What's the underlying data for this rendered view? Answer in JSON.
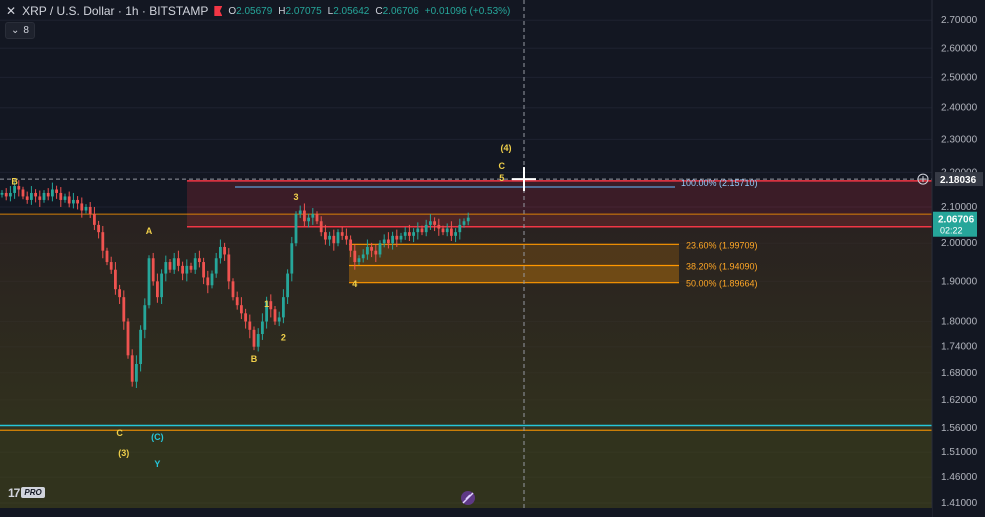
{
  "header": {
    "symbol": "XRP / U.S. Dollar · 1h · BITSTAMP",
    "ohlc": {
      "o": "2.05679",
      "h": "2.07075",
      "l": "2.05642",
      "c": "2.06706",
      "change": "+0.01096 (+0.53%)"
    },
    "indicators_count": "8"
  },
  "colors": {
    "background": "#131722",
    "up": "#26a69a",
    "down": "#ef5350",
    "fib_line": "#ff9800",
    "pink_zone": "#f23645",
    "cyan_line": "#26c6da",
    "wave_yellow": "#f0d04a",
    "wave_teal": "#26c6da",
    "label_orange": "#ffa726",
    "label_blue": "#90caf9"
  },
  "icons": {
    "close": "close-icon",
    "collapse": "chevron-down-icon",
    "add_price": "plus-circle-icon",
    "logo": "tradingview-logo",
    "rocket": "rocket-icon"
  },
  "price_axis": {
    "ticks": [
      "2.70000",
      "2.60000",
      "2.50000",
      "2.40000",
      "2.30000",
      "2.20000",
      "2.10000",
      "2.00000",
      "1.90000",
      "1.80000",
      "1.74000",
      "1.68000",
      "1.62000",
      "1.56000",
      "1.51000",
      "1.46000",
      "1.41000"
    ],
    "crosshair_price": "2.18036",
    "current_price": "2.06706",
    "countdown": "02:22"
  },
  "fib_labels": [
    {
      "text": "100.00% (2.15710)",
      "price": 2.1571
    },
    {
      "text": "23.60% (1.99709)",
      "price": 1.99709
    },
    {
      "text": "38.20% (1.94090)",
      "price": 1.9409
    },
    {
      "text": "50.00% (1.89664)",
      "price": 1.89664
    }
  ],
  "wave_labels": [
    {
      "text": "B",
      "bar": 3,
      "price": 2.165,
      "color": "yellow"
    },
    {
      "text": "A",
      "bar": 35,
      "price": 2.025,
      "color": "yellow"
    },
    {
      "text": "1",
      "bar": 63,
      "price": 1.835,
      "color": "yellow"
    },
    {
      "text": "2",
      "bar": 67,
      "price": 1.755,
      "color": "yellow"
    },
    {
      "text": "B",
      "bar": 60,
      "price": 1.705,
      "color": "yellow"
    },
    {
      "text": "3",
      "bar": 70,
      "price": 2.12,
      "color": "yellow"
    },
    {
      "text": "4",
      "bar": 84,
      "price": 1.885,
      "color": "yellow"
    },
    {
      "text": "(4)",
      "bar": 120,
      "price": 2.265,
      "color": "yellow"
    },
    {
      "text": "C",
      "bar": 119,
      "price": 2.21,
      "color": "yellow"
    },
    {
      "text": "5",
      "bar": 119,
      "price": 2.175,
      "color": "yellow"
    },
    {
      "text": "C",
      "bar": 28,
      "price": 1.543,
      "color": "yellow"
    },
    {
      "text": "(C)",
      "bar": 37,
      "price": 1.535,
      "color": "teal"
    },
    {
      "text": "(3)",
      "bar": 29,
      "price": 1.502,
      "color": "yellow"
    },
    {
      "text": "Y",
      "bar": 37,
      "price": 1.48,
      "color": "teal"
    }
  ],
  "chart_data": {
    "type": "candlestick",
    "title": "XRP / U.S. Dollar · 1h · BITSTAMP",
    "y_scale": "log",
    "ylim": [
      1.41,
      2.73
    ],
    "grid": true,
    "levels": {
      "fib_100": 2.1571,
      "fib_0": 2.08,
      "fib_236": 1.99709,
      "fib_382": 1.9409,
      "fib_50": 1.89664,
      "pink_zone_top": 2.175,
      "pink_zone_bottom": 2.045,
      "cyan_line": 1.565,
      "orange_support": 1.555
    },
    "close": [
      2.14,
      2.13,
      2.14,
      2.16,
      2.15,
      2.13,
      2.12,
      2.14,
      2.13,
      2.12,
      2.14,
      2.13,
      2.15,
      2.14,
      2.12,
      2.13,
      2.11,
      2.12,
      2.11,
      2.09,
      2.1,
      2.08,
      2.05,
      2.03,
      1.98,
      1.95,
      1.93,
      1.88,
      1.86,
      1.8,
      1.72,
      1.66,
      1.7,
      1.78,
      1.84,
      1.96,
      1.9,
      1.86,
      1.92,
      1.95,
      1.93,
      1.96,
      1.94,
      1.92,
      1.94,
      1.93,
      1.96,
      1.95,
      1.91,
      1.89,
      1.92,
      1.96,
      1.99,
      1.97,
      1.9,
      1.86,
      1.84,
      1.82,
      1.8,
      1.78,
      1.74,
      1.77,
      1.8,
      1.85,
      1.83,
      1.8,
      1.81,
      1.86,
      1.92,
      2.0,
      2.08,
      2.09,
      2.06,
      2.07,
      2.08,
      2.06,
      2.03,
      2.01,
      2.02,
      2.0,
      2.03,
      2.02,
      2.01,
      1.98,
      1.95,
      1.96,
      1.97,
      1.99,
      1.98,
      1.97,
      2.0,
      2.01,
      2.0,
      2.02,
      2.01,
      2.02,
      2.03,
      2.02,
      2.03,
      2.04,
      2.03,
      2.05,
      2.06,
      2.05,
      2.04,
      2.03,
      2.04,
      2.02,
      2.03,
      2.05,
      2.06,
      2.07
    ]
  }
}
